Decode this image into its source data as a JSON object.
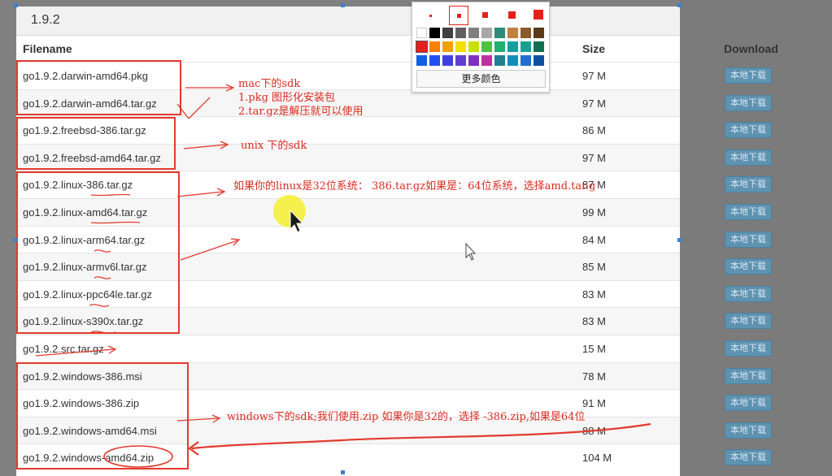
{
  "version_title": "1.9.2",
  "columns": {
    "filename": "Filename",
    "size": "Size",
    "download": "Download"
  },
  "download_label": "本地下载",
  "files": [
    {
      "name": "go1.9.2.darwin-amd64.pkg",
      "size": "97 M"
    },
    {
      "name": "go1.9.2.darwin-amd64.tar.gz",
      "size": "97 M"
    },
    {
      "name": "go1.9.2.freebsd-386.tar.gz",
      "size": "86 M"
    },
    {
      "name": "go1.9.2.freebsd-amd64.tar.gz",
      "size": "97 M"
    },
    {
      "name": "go1.9.2.linux-386.tar.gz",
      "size": "87 M"
    },
    {
      "name": "go1.9.2.linux-amd64.tar.gz",
      "size": "99 M"
    },
    {
      "name": "go1.9.2.linux-arm64.tar.gz",
      "size": "84 M"
    },
    {
      "name": "go1.9.2.linux-armv6l.tar.gz",
      "size": "85 M"
    },
    {
      "name": "go1.9.2.linux-ppc64le.tar.gz",
      "size": "83 M"
    },
    {
      "name": "go1.9.2.linux-s390x.tar.gz",
      "size": "83 M"
    },
    {
      "name": "go1.9.2.src.tar.gz",
      "size": "15 M"
    },
    {
      "name": "go1.9.2.windows-386.msi",
      "size": "78 M"
    },
    {
      "name": "go1.9.2.windows-386.zip",
      "size": "91 M"
    },
    {
      "name": "go1.9.2.windows-amd64.msi",
      "size": "88 M"
    },
    {
      "name": "go1.9.2.windows-amd64.zip",
      "size": "104 M"
    }
  ],
  "annotations": {
    "mac_title": "mac下的sdk",
    "mac_line1": "1.pkg 图形化安装包",
    "mac_line2": "2.tar.gz是解压就可以使用",
    "unix": "unix 下的sdk",
    "linux": "如果你的linux是32位系统： 386.tar.gz如果是：64位系统，选择amd.tar.g",
    "windows": "windows下的sdk;我们使用.zip 如果你是32的，选择 -386.zip,如果是64位"
  },
  "color_picker": {
    "more_colors_label": "更多颜色",
    "brush_color": "#e5201c",
    "swatch_rows": [
      [
        "#ffffff",
        "#000000",
        "#404040",
        "#606060",
        "#808080",
        "#a8a8a8",
        "#2e8b7a",
        "#c08040",
        "#8b5a2b",
        "#5a3a1a"
      ],
      [
        "#e5201c",
        "#ff7f00",
        "#f0a000",
        "#f5e000",
        "#c8e000",
        "#4fc040",
        "#20b070",
        "#10a0a0",
        "#1aa090",
        "#107050"
      ],
      [
        "#1060e0",
        "#2050f0",
        "#4040e0",
        "#6040d0",
        "#8030c0",
        "#c030a0",
        "#208090",
        "#1090c0",
        "#2070d0",
        "#1050a0"
      ]
    ]
  }
}
